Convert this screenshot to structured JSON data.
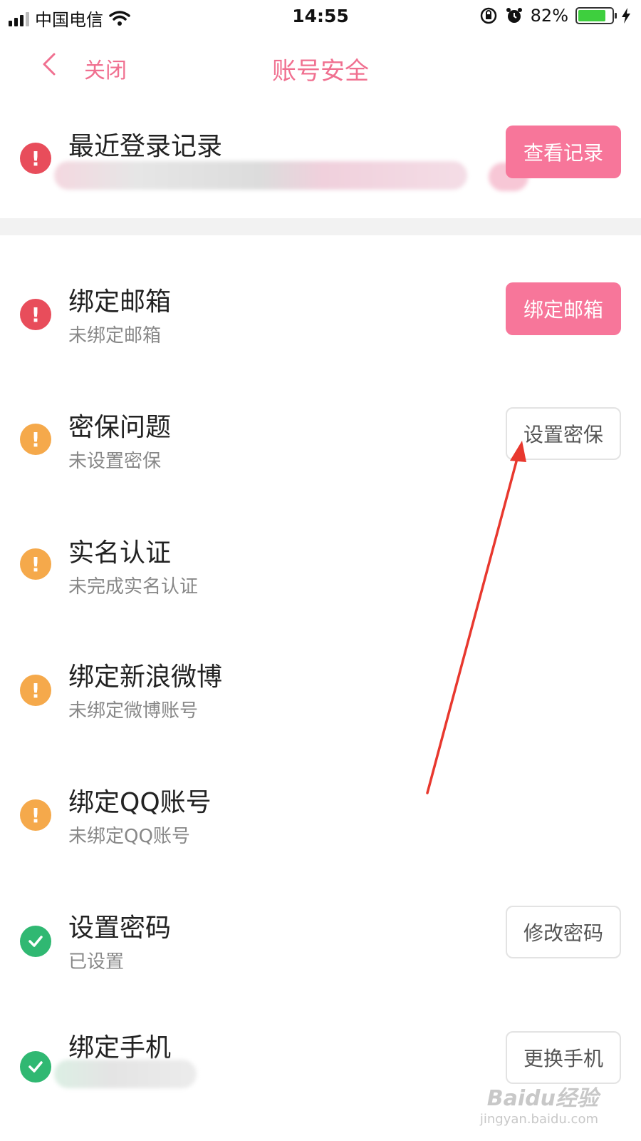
{
  "status_bar": {
    "carrier": "中国电信",
    "time": "14:55",
    "battery_percent": "82%",
    "battery_level": 0.82
  },
  "nav": {
    "back_icon": "chevron-left-icon",
    "close_label": "关闭",
    "title": "账号安全"
  },
  "items": [
    {
      "title": "最近登录记录",
      "subtitle": "",
      "status": "warning-red",
      "button": "查看记录",
      "button_style": "filled"
    },
    {
      "title": "绑定邮箱",
      "subtitle": "未绑定邮箱",
      "status": "warning-red",
      "button": "绑定邮箱",
      "button_style": "filled"
    },
    {
      "title": "密保问题",
      "subtitle": "未设置密保",
      "status": "warning-orange",
      "button": "设置密保",
      "button_style": "outline"
    },
    {
      "title": "实名认证",
      "subtitle": "未完成实名认证",
      "status": "warning-orange",
      "button": "",
      "button_style": "none"
    },
    {
      "title": "绑定新浪微博",
      "subtitle": "未绑定微博账号",
      "status": "warning-orange",
      "button": "",
      "button_style": "none"
    },
    {
      "title": "绑定QQ账号",
      "subtitle": "未绑定QQ账号",
      "status": "warning-orange",
      "button": "",
      "button_style": "none"
    },
    {
      "title": "设置密码",
      "subtitle": "已设置",
      "status": "ok-green",
      "button": "修改密码",
      "button_style": "outline"
    },
    {
      "title": "绑定手机",
      "subtitle": "",
      "status": "ok-green",
      "button": "更换手机",
      "button_style": "outline"
    }
  ],
  "colors": {
    "accent": "#f07090",
    "button_pink": "#f7769a",
    "red": "#e84d5b",
    "orange": "#f5a94b",
    "green": "#30b872"
  },
  "watermark": {
    "logo": "Baidu经验",
    "url": "jingyan.baidu.com"
  }
}
